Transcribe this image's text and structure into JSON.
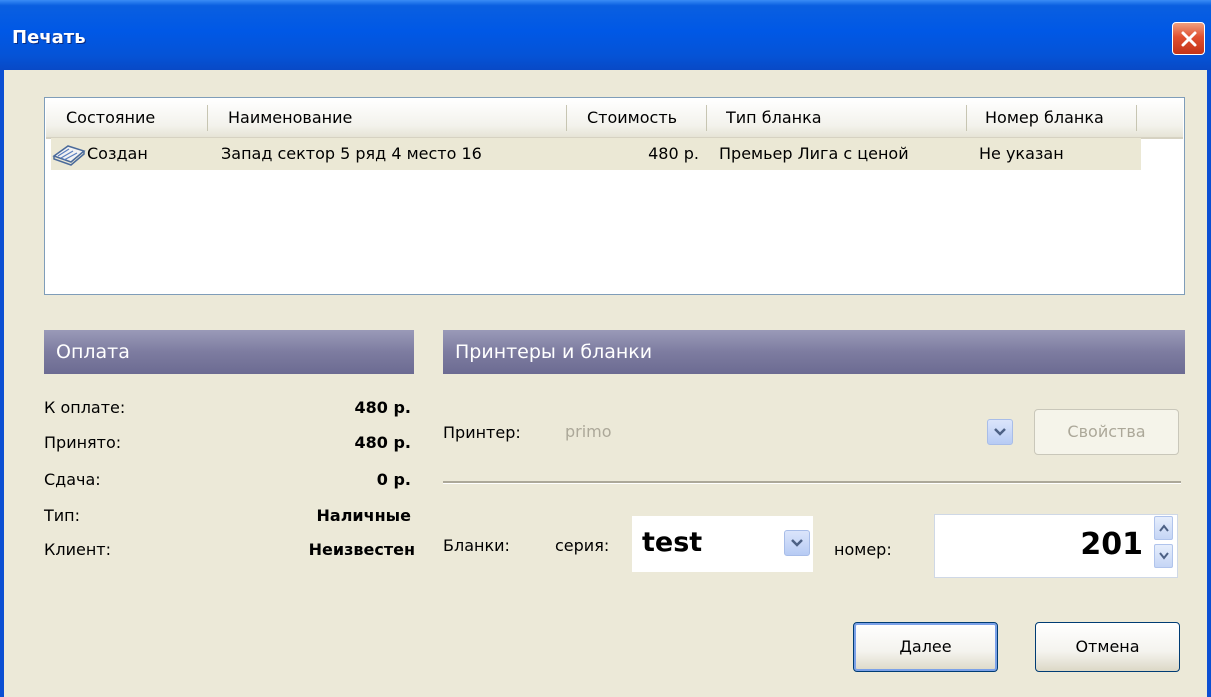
{
  "window": {
    "title": "Печать",
    "close_icon": "close-x-icon",
    "accent_color": "#0058e6"
  },
  "list": {
    "columns": [
      "Состояние",
      "Наименование",
      "Стоимость",
      "Тип бланка",
      "Номер бланка"
    ],
    "rows": [
      {
        "icon": "document-icon",
        "status": "Создан",
        "name": "Запад сектор 5 ряд 4 место 16",
        "cost": "480 р.",
        "form_type": "Премьер Лига с ценой",
        "form_number": "Не указан"
      }
    ]
  },
  "payment": {
    "header": "Оплата",
    "rows": [
      {
        "label": "К оплате:",
        "value": "480 р."
      },
      {
        "label": "Принято:",
        "value": "480 р."
      },
      {
        "label": "Сдача:",
        "value": "0 р."
      },
      {
        "label": "Тип:",
        "value": "Наличные"
      },
      {
        "label": "Клиент:",
        "value": "Неизвестен"
      }
    ]
  },
  "printers": {
    "header": "Принтеры и бланки",
    "printer_label": "Принтер:",
    "printer_value": "primo",
    "properties_button": "Свойства",
    "forms_label": "Бланки:",
    "series_label": "серия:",
    "series_value": "test",
    "number_label": "номер:",
    "number_value": "201"
  },
  "buttons": {
    "next": "Далее",
    "cancel": "Отмена"
  }
}
